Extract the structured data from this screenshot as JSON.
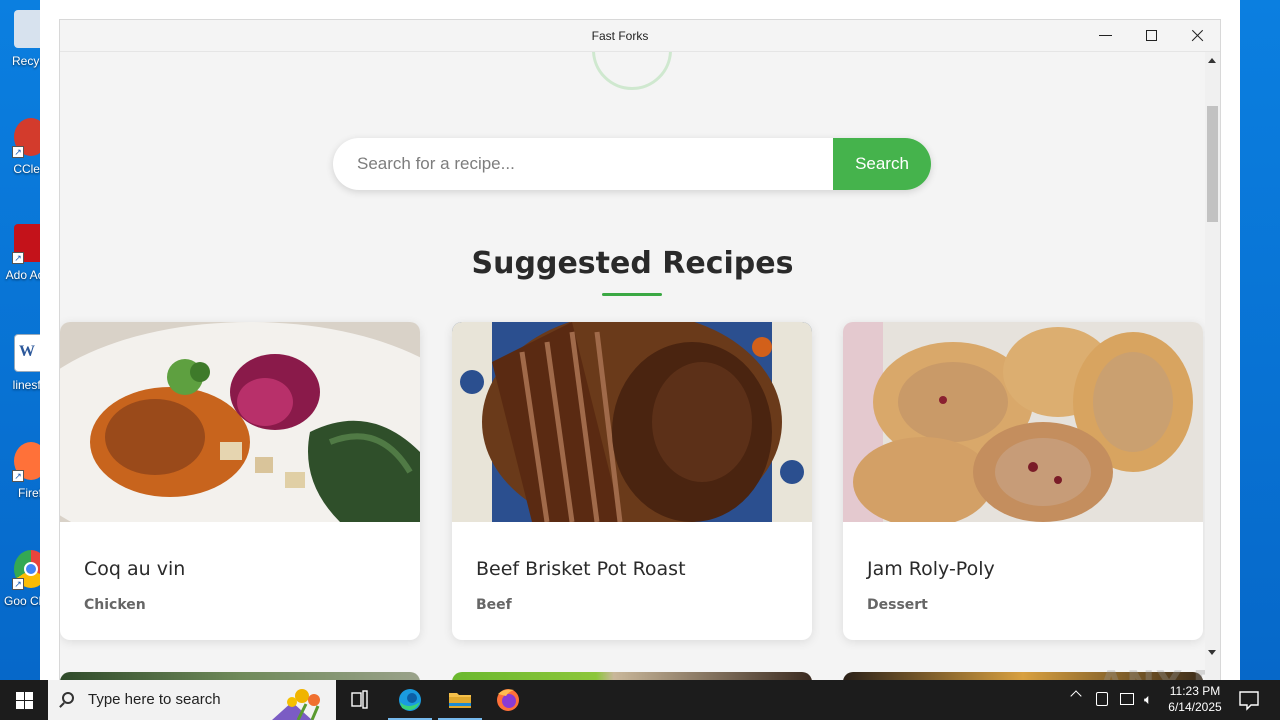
{
  "desktop": {
    "icons": [
      {
        "label": "Recycl",
        "icon": "recycle-bin-icon",
        "color": "#cfd8e4"
      },
      {
        "label": "CClea",
        "icon": "ccleaner-icon",
        "color": "#d33b2c"
      },
      {
        "label": "Ado Acro",
        "icon": "adobe-acrobat-icon",
        "color": "#c4121a"
      },
      {
        "label": "linesfri",
        "icon": "word-document-icon",
        "color": "#ffffff"
      },
      {
        "label": "Firef",
        "icon": "firefox-icon",
        "color": "#ff7139"
      },
      {
        "label": "Goo Chro",
        "icon": "chrome-icon",
        "color": "#e8453c"
      }
    ]
  },
  "window": {
    "title": "Fast Forks",
    "controls": {
      "minimize": "minimize-icon",
      "maximize": "maximize-icon",
      "close": "close-icon"
    }
  },
  "search": {
    "placeholder": "Search for a recipe...",
    "button_label": "Search"
  },
  "section": {
    "title": "Suggested Recipes"
  },
  "recipes": [
    {
      "name": "Coq au vin",
      "category": "Chicken"
    },
    {
      "name": "Beef Brisket Pot Roast",
      "category": "Beef"
    },
    {
      "name": "Jam Roly-Poly",
      "category": "Dessert"
    }
  ],
  "watermark": "ANY.RUN",
  "taskbar": {
    "search_placeholder": "Type here to search",
    "time": "11:23 PM",
    "date": "6/14/2025"
  },
  "colors": {
    "accent": "#45b34c",
    "desktop": "#0b7fe0",
    "taskbar": "#1c1c1c"
  }
}
